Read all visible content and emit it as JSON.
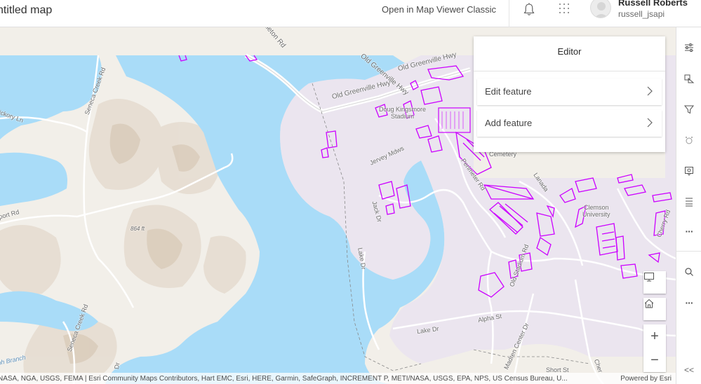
{
  "header": {
    "title": "ntitled map",
    "open_classic": "Open in Map Viewer Classic",
    "user_name": "Russell Roberts",
    "user_id": "russell_jsapi"
  },
  "editor": {
    "title": "Editor",
    "items": [
      {
        "label": "Edit feature"
      },
      {
        "label": "Add feature"
      }
    ]
  },
  "map_labels": {
    "road_old_greenville_hwy_1": "Old Greenville Hwy",
    "road_old_greenville_hwy_2": "Old Greenville Hwy",
    "road_old_greenville_hwy_3": "Old Greenville Hwy",
    "road_pendleton": "ndleton Rd",
    "road_seneca_creek_1": "Seneca Creek Rd",
    "road_seneca_creek_2": "Seneca Creek Rd",
    "road_hickory": "ickory Ln",
    "road_port": "port Rd",
    "elevation": "864 ft",
    "stadium": "Doug Kingsmore\nStadium",
    "road_jervey": "Jervey Mdws",
    "road_jack": "Jack Dr",
    "road_perimeter": "Perimeter Rd",
    "cemetery": "Cemetery",
    "road_lanada": "Lanada",
    "university": "Clemson\nUniversity",
    "road_cherry": "Cherry Rd",
    "road_lake_dr_1": "Lake Dr",
    "road_lake_dr_2": "Lake Dr",
    "road_old_stadium": "Old Stadium Rd",
    "road_alpha": "Alpha St",
    "road_madren": "Madren Center Dr",
    "road_short": "Short St",
    "road_cher": "Cher",
    "branch": "ph Branch",
    "road_dr": "Dr"
  },
  "attribution": {
    "text": "NASA, NGA, USGS, FEMA | Esri Community Maps Contributors, Hart EMC, Esri, HERE, Garmin, SafeGraph, INCREMENT P, METI/NASA, USGS, EPA, NPS, US Census Bureau, U...",
    "powered": "Powered by Esri"
  },
  "widgets": {
    "zoom_in": "+",
    "zoom_out": "−"
  },
  "toolbar": {
    "more_1": "···",
    "more_2": "···",
    "collapse": "<<"
  },
  "colors": {
    "water": "#a9dcf8",
    "campus": "#ebe5ef",
    "feature_outline": "#cc00ff",
    "terrain": "#f2efe9"
  }
}
